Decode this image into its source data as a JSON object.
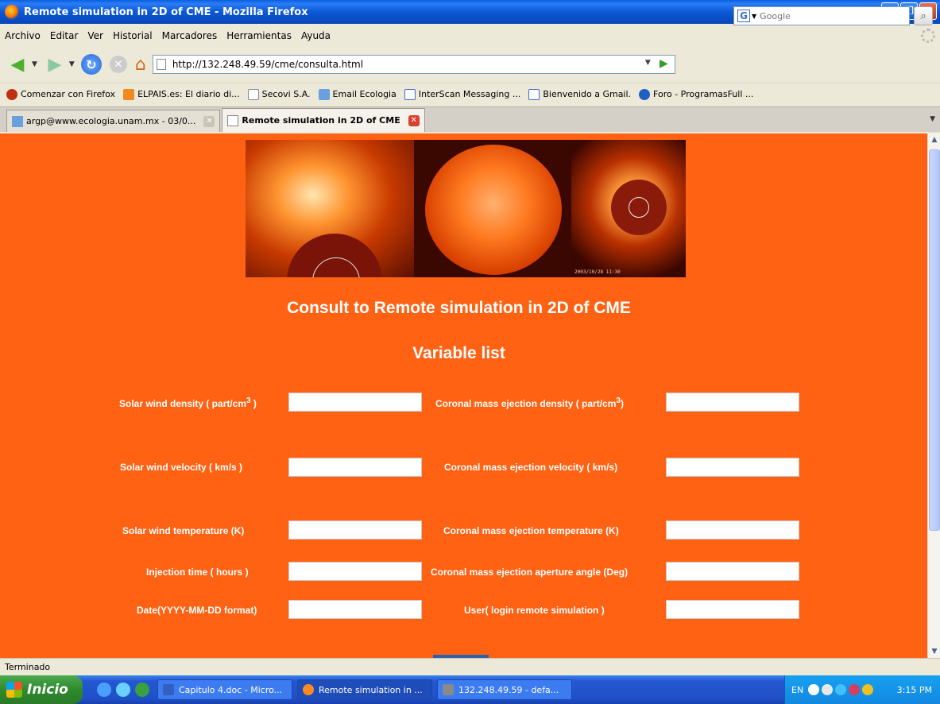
{
  "window": {
    "title": "Remote simulation in 2D of CME - Mozilla Firefox"
  },
  "menu": [
    "Archivo",
    "Editar",
    "Ver",
    "Historial",
    "Marcadores",
    "Herramientas",
    "Ayuda"
  ],
  "nav": {
    "url": "http://132.248.49.59/cme/consulta.html",
    "search_placeholder": "Google"
  },
  "bookmarks": [
    {
      "label": "Comenzar con Firefox",
      "icon": "firefox-icon"
    },
    {
      "label": "ELPAIS.es: El diario di...",
      "icon": "rss-icon"
    },
    {
      "label": "Secovi S.A.",
      "icon": "page-icon"
    },
    {
      "label": "Email Ecologia",
      "icon": "mail-icon"
    },
    {
      "label": "InterScan Messaging ...",
      "icon": "google-icon"
    },
    {
      "label": "Bienvenido a Gmail.",
      "icon": "google-icon"
    },
    {
      "label": "Foro - ProgramasFull ...",
      "icon": "forum-icon"
    }
  ],
  "tabs": [
    {
      "label": "argp@www.ecologia.unam.mx - 03/0...",
      "active": false
    },
    {
      "label": "Remote simulation in 2D of CME",
      "active": true
    }
  ],
  "page": {
    "banner_stamp": "2003/10/28 11:30",
    "heading": "Consult to Remote simulation in 2D of CME",
    "subheading": "Variable list",
    "fields": {
      "sw_density": {
        "label": "Solar wind density ( part/cm",
        "sup": "3",
        "tail": " )",
        "value": ""
      },
      "cme_density": {
        "label": "Coronal mass ejection density ( part/cm",
        "sup": "3",
        "tail": ")",
        "value": ""
      },
      "sw_velocity": {
        "label": "Solar wind velocity ( km/s )",
        "value": ""
      },
      "cme_velocity": {
        "label": "Coronal mass ejection velocity ( km/s)",
        "value": ""
      },
      "sw_temperature": {
        "label": "Solar wind temperature (K)",
        "value": ""
      },
      "cme_temperature": {
        "label": "Coronal mass ejection temperature (K)",
        "value": ""
      },
      "injection_time": {
        "label": "Injection time ( hours )",
        "value": ""
      },
      "aperture_angle": {
        "label": "Coronal mass ejection aperture angle (Deg)",
        "value": ""
      },
      "date": {
        "label": "Date(YYYY-MM-DD format)",
        "value": ""
      },
      "user": {
        "label": "User( login remote simulation )",
        "value": ""
      }
    }
  },
  "status": "Terminado",
  "taskbar": {
    "start": "Inicio",
    "items": [
      {
        "label": "Capitulo 4.doc - Micro..."
      },
      {
        "label": "Remote simulation in ..."
      },
      {
        "label": "132.248.49.59 - defa..."
      }
    ],
    "lang": "EN",
    "clock": "3:15 PM"
  },
  "colors": {
    "page_bg": "#ff6213",
    "heading": "#ffffff"
  }
}
